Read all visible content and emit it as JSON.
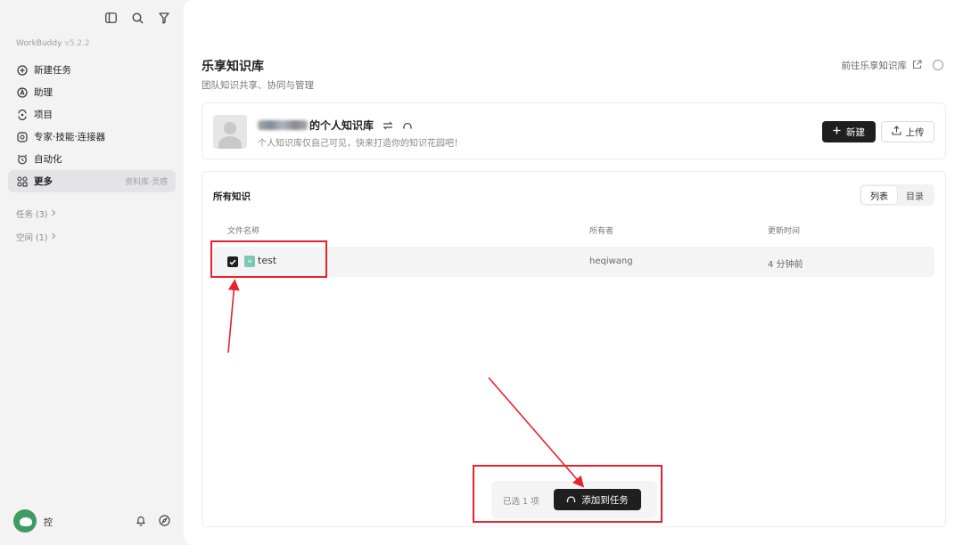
{
  "sidebar": {
    "brand": "WorkBuddy",
    "version": "v5.2.2",
    "nav": [
      {
        "label": "新建任务",
        "icon": "plus-circle-icon"
      },
      {
        "label": "助理",
        "icon": "assistant-icon"
      },
      {
        "label": "项目",
        "icon": "project-icon"
      },
      {
        "label": "专家·技能·连接器",
        "icon": "expert-icon"
      },
      {
        "label": "自动化",
        "icon": "alarm-clock-icon"
      },
      {
        "label": "更多",
        "icon": "more-grid-icon",
        "hint": "资料库·灵感"
      }
    ],
    "groups": [
      {
        "label": "任务 (3)"
      },
      {
        "label": "空间 (1)"
      }
    ],
    "user": {
      "name": "控"
    }
  },
  "header": {
    "title": "乐享知识库",
    "subtitle": "团队知识共享、协同与管理",
    "goto_label": "前往乐享知识库"
  },
  "personal_kb": {
    "name_suffix": "的个人知识库",
    "description": "个人知识库仅自己可见，快来打造你的知识花园吧！",
    "new_label": "新建",
    "upload_label": "上传"
  },
  "list": {
    "title": "所有知识",
    "views": [
      "列表",
      "目录"
    ],
    "columns": {
      "name": "文件名称",
      "owner": "所有者",
      "updated": "更新时间"
    },
    "rows": [
      {
        "name": "test",
        "owner": "heqiwang",
        "updated": "4 分钟前",
        "checked": true
      }
    ]
  },
  "selection": {
    "count_label": "已选 1 项",
    "add_label": "添加到任务"
  },
  "colors": {
    "accent_dark": "#1f1f1f",
    "annotation": "#e8212b"
  }
}
